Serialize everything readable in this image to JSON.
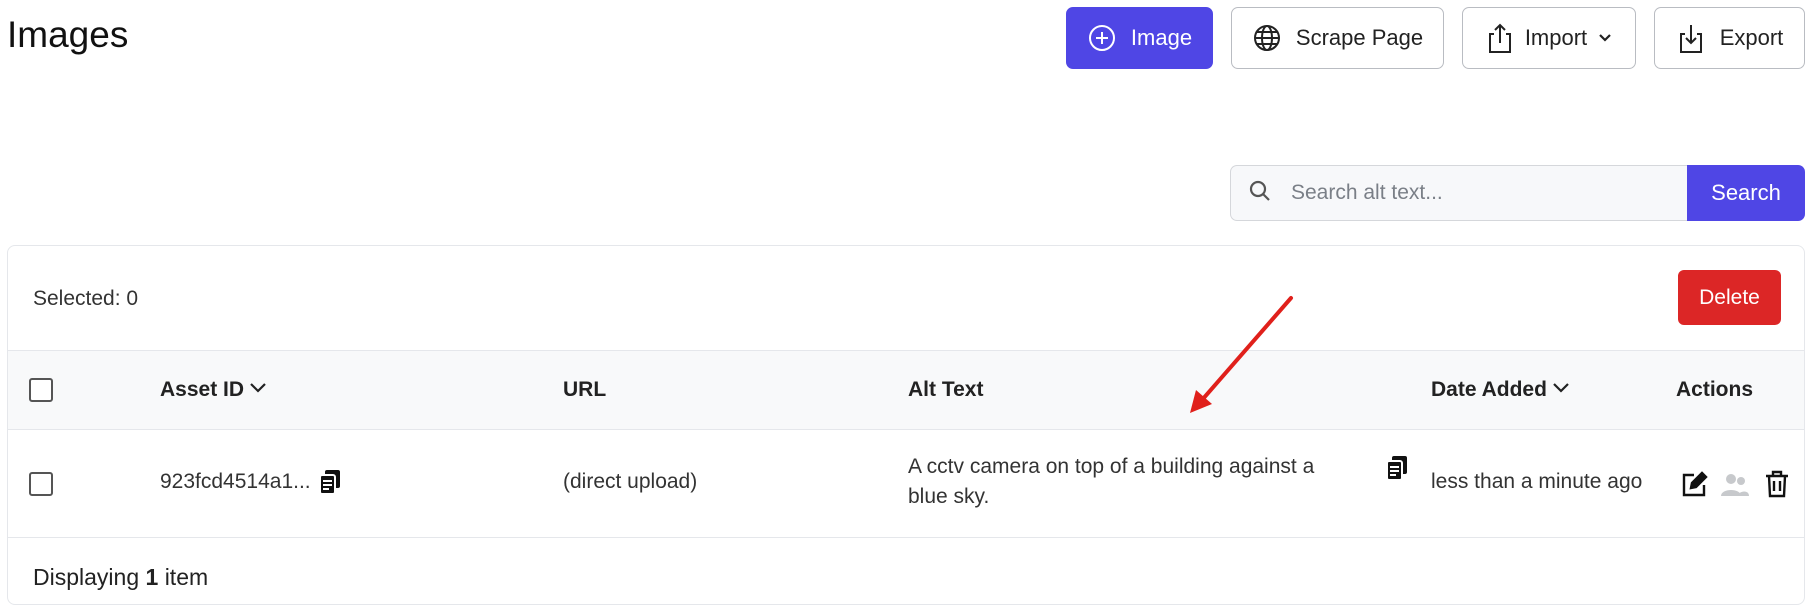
{
  "header": {
    "title": "Images",
    "buttons": {
      "image": "Image",
      "scrape": "Scrape Page",
      "import": "Import",
      "export": "Export"
    }
  },
  "search": {
    "placeholder": "Search alt text...",
    "value": "",
    "button_label": "Search"
  },
  "table_panel": {
    "selected_label": "Selected: 0",
    "delete_label": "Delete",
    "columns": {
      "asset_id": "Asset ID",
      "url": "URL",
      "alt_text": "Alt Text",
      "date_added": "Date Added",
      "actions": "Actions"
    },
    "rows": [
      {
        "asset_id": "923fcd4514a1...",
        "url": "(direct upload)",
        "alt_text": "A cctv camera on top of a building against a blue sky.",
        "date_added": "less than a minute ago",
        "selected": false
      }
    ],
    "footer": {
      "prefix": "Displaying",
      "count": "1",
      "suffix": "item"
    }
  },
  "colors": {
    "primary": "#4f46e5",
    "danger": "#dc2626",
    "annotation_arrow": "#e0201b"
  },
  "icons": [
    "plus-circle-icon",
    "globe-icon",
    "upload-icon",
    "chevron-down-icon",
    "download-icon",
    "search-icon",
    "copy-icon",
    "edit-icon",
    "users-icon",
    "trash-icon"
  ]
}
